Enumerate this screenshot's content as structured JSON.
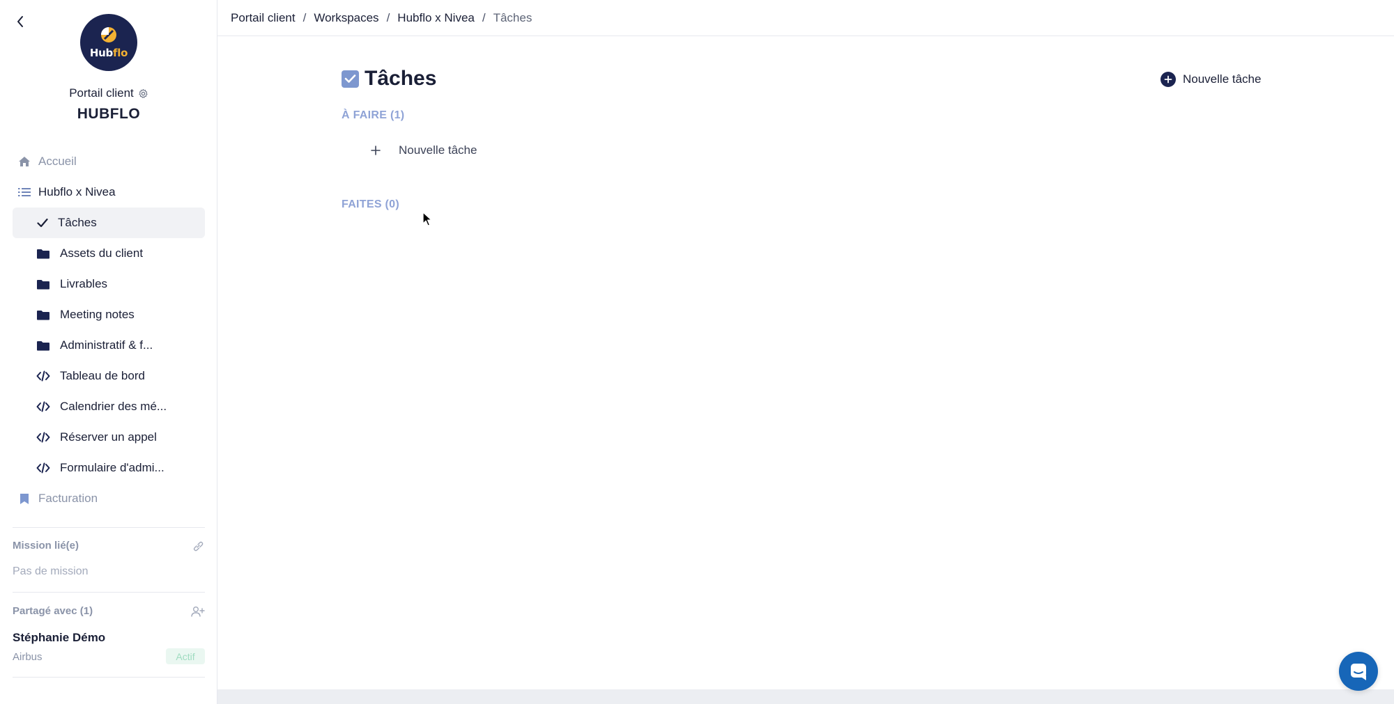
{
  "sidebar": {
    "portal_label": "Portail client",
    "company_name": "HUBFLO",
    "logo": {
      "text_main": "Hub",
      "text_accent": "flo"
    },
    "nav": {
      "home": "Accueil",
      "workspace": "Hubflo x Nivea",
      "items": [
        {
          "label": "Tâches",
          "icon": "check-icon"
        },
        {
          "label": "Assets du client",
          "icon": "folder-icon"
        },
        {
          "label": "Livrables",
          "icon": "folder-icon"
        },
        {
          "label": "Meeting notes",
          "icon": "folder-icon"
        },
        {
          "label": "Administratif & f...",
          "icon": "folder-icon"
        },
        {
          "label": "Tableau de bord",
          "icon": "code-icon"
        },
        {
          "label": "Calendrier des mé...",
          "icon": "code-icon"
        },
        {
          "label": "Réserver un appel",
          "icon": "code-icon"
        },
        {
          "label": "Formulaire d'admi...",
          "icon": "code-icon"
        }
      ],
      "billing": "Facturation"
    },
    "mission": {
      "title": "Mission lié(e)",
      "empty": "Pas de mission"
    },
    "shared": {
      "title": "Partagé avec (1)",
      "user_name": "Stéphanie Démo",
      "user_company": "Airbus",
      "status": "Actif"
    }
  },
  "breadcrumb": [
    "Portail client",
    "Workspaces",
    "Hubflo x Nivea",
    "Tâches"
  ],
  "main": {
    "title": "Tâches",
    "new_task_button": "Nouvelle tâche",
    "todo_group": "À FAIRE (1)",
    "inline_new_task": "Nouvelle tâche",
    "done_group": "FAITES (0)"
  },
  "colors": {
    "brand_navy": "#1b2450",
    "accent_yellow": "#f3b132",
    "group_title_blue": "#8fa3d6",
    "chat_blue": "#1766b8",
    "status_green": "#9fdcc0"
  }
}
